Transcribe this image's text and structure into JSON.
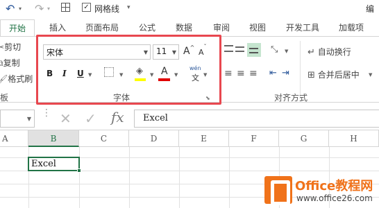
{
  "qat": {
    "gridlines_label": "网格线",
    "gridlines_checked": "✓",
    "edit_label": "编"
  },
  "tabs": [
    {
      "label": "开始",
      "active": true
    },
    {
      "label": "插入"
    },
    {
      "label": "页面布局"
    },
    {
      "label": "公式"
    },
    {
      "label": "数据"
    },
    {
      "label": "审阅"
    },
    {
      "label": "视图"
    },
    {
      "label": "开发工具"
    },
    {
      "label": "加载项"
    }
  ],
  "clipboard": {
    "cut": "剪切",
    "copy": "复制",
    "format_painter": "格式刷",
    "group_label": "板"
  },
  "font": {
    "name": "宋体",
    "size": "11",
    "increase": "A",
    "decrease": "A",
    "bold": "B",
    "italic": "I",
    "underline": "U",
    "font_color_letter": "A",
    "phonetic_top": "wén",
    "phonetic_bottom": "文",
    "group_label": "字体"
  },
  "alignment": {
    "wrap_text": "自动换行",
    "merge_center": "合并后居中",
    "group_label": "对齐方式"
  },
  "formula_bar": {
    "fx": "fx",
    "value": "Excel"
  },
  "columns": [
    "A",
    "B",
    "C",
    "D",
    "E",
    "F",
    "G",
    "H"
  ],
  "active_cell": {
    "value": "Excel"
  },
  "colors": {
    "accent": "#217346",
    "highlight": "#e8474f",
    "fill_color": "#ffff00",
    "font_color": "#e00000"
  },
  "watermark": {
    "title": "Office教程网",
    "url": "www.office26.com"
  }
}
